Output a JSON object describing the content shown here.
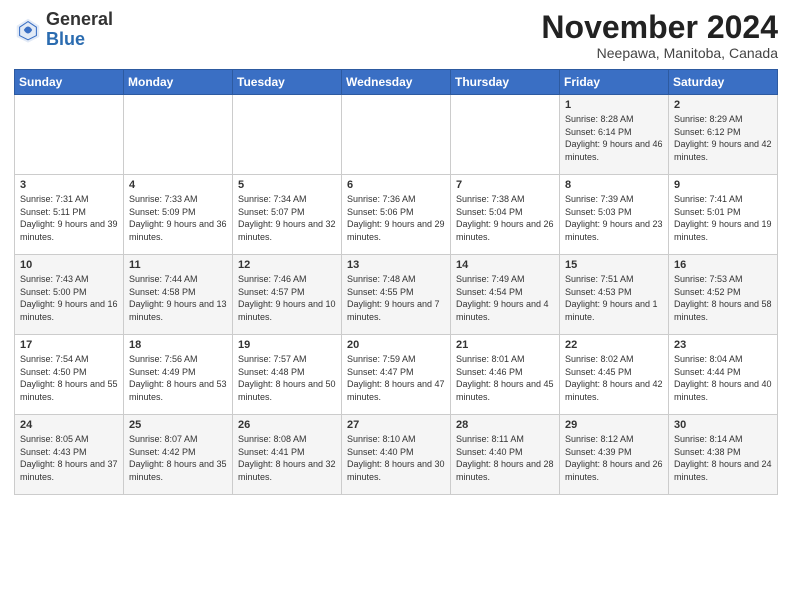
{
  "logo": {
    "general": "General",
    "blue": "Blue"
  },
  "title": "November 2024",
  "location": "Neepawa, Manitoba, Canada",
  "days_of_week": [
    "Sunday",
    "Monday",
    "Tuesday",
    "Wednesday",
    "Thursday",
    "Friday",
    "Saturday"
  ],
  "weeks": [
    [
      {
        "day": "",
        "info": ""
      },
      {
        "day": "",
        "info": ""
      },
      {
        "day": "",
        "info": ""
      },
      {
        "day": "",
        "info": ""
      },
      {
        "day": "",
        "info": ""
      },
      {
        "day": "1",
        "info": "Sunrise: 8:28 AM\nSunset: 6:14 PM\nDaylight: 9 hours and 46 minutes."
      },
      {
        "day": "2",
        "info": "Sunrise: 8:29 AM\nSunset: 6:12 PM\nDaylight: 9 hours and 42 minutes."
      }
    ],
    [
      {
        "day": "3",
        "info": "Sunrise: 7:31 AM\nSunset: 5:11 PM\nDaylight: 9 hours and 39 minutes."
      },
      {
        "day": "4",
        "info": "Sunrise: 7:33 AM\nSunset: 5:09 PM\nDaylight: 9 hours and 36 minutes."
      },
      {
        "day": "5",
        "info": "Sunrise: 7:34 AM\nSunset: 5:07 PM\nDaylight: 9 hours and 32 minutes."
      },
      {
        "day": "6",
        "info": "Sunrise: 7:36 AM\nSunset: 5:06 PM\nDaylight: 9 hours and 29 minutes."
      },
      {
        "day": "7",
        "info": "Sunrise: 7:38 AM\nSunset: 5:04 PM\nDaylight: 9 hours and 26 minutes."
      },
      {
        "day": "8",
        "info": "Sunrise: 7:39 AM\nSunset: 5:03 PM\nDaylight: 9 hours and 23 minutes."
      },
      {
        "day": "9",
        "info": "Sunrise: 7:41 AM\nSunset: 5:01 PM\nDaylight: 9 hours and 19 minutes."
      }
    ],
    [
      {
        "day": "10",
        "info": "Sunrise: 7:43 AM\nSunset: 5:00 PM\nDaylight: 9 hours and 16 minutes."
      },
      {
        "day": "11",
        "info": "Sunrise: 7:44 AM\nSunset: 4:58 PM\nDaylight: 9 hours and 13 minutes."
      },
      {
        "day": "12",
        "info": "Sunrise: 7:46 AM\nSunset: 4:57 PM\nDaylight: 9 hours and 10 minutes."
      },
      {
        "day": "13",
        "info": "Sunrise: 7:48 AM\nSunset: 4:55 PM\nDaylight: 9 hours and 7 minutes."
      },
      {
        "day": "14",
        "info": "Sunrise: 7:49 AM\nSunset: 4:54 PM\nDaylight: 9 hours and 4 minutes."
      },
      {
        "day": "15",
        "info": "Sunrise: 7:51 AM\nSunset: 4:53 PM\nDaylight: 9 hours and 1 minute."
      },
      {
        "day": "16",
        "info": "Sunrise: 7:53 AM\nSunset: 4:52 PM\nDaylight: 8 hours and 58 minutes."
      }
    ],
    [
      {
        "day": "17",
        "info": "Sunrise: 7:54 AM\nSunset: 4:50 PM\nDaylight: 8 hours and 55 minutes."
      },
      {
        "day": "18",
        "info": "Sunrise: 7:56 AM\nSunset: 4:49 PM\nDaylight: 8 hours and 53 minutes."
      },
      {
        "day": "19",
        "info": "Sunrise: 7:57 AM\nSunset: 4:48 PM\nDaylight: 8 hours and 50 minutes."
      },
      {
        "day": "20",
        "info": "Sunrise: 7:59 AM\nSunset: 4:47 PM\nDaylight: 8 hours and 47 minutes."
      },
      {
        "day": "21",
        "info": "Sunrise: 8:01 AM\nSunset: 4:46 PM\nDaylight: 8 hours and 45 minutes."
      },
      {
        "day": "22",
        "info": "Sunrise: 8:02 AM\nSunset: 4:45 PM\nDaylight: 8 hours and 42 minutes."
      },
      {
        "day": "23",
        "info": "Sunrise: 8:04 AM\nSunset: 4:44 PM\nDaylight: 8 hours and 40 minutes."
      }
    ],
    [
      {
        "day": "24",
        "info": "Sunrise: 8:05 AM\nSunset: 4:43 PM\nDaylight: 8 hours and 37 minutes."
      },
      {
        "day": "25",
        "info": "Sunrise: 8:07 AM\nSunset: 4:42 PM\nDaylight: 8 hours and 35 minutes."
      },
      {
        "day": "26",
        "info": "Sunrise: 8:08 AM\nSunset: 4:41 PM\nDaylight: 8 hours and 32 minutes."
      },
      {
        "day": "27",
        "info": "Sunrise: 8:10 AM\nSunset: 4:40 PM\nDaylight: 8 hours and 30 minutes."
      },
      {
        "day": "28",
        "info": "Sunrise: 8:11 AM\nSunset: 4:40 PM\nDaylight: 8 hours and 28 minutes."
      },
      {
        "day": "29",
        "info": "Sunrise: 8:12 AM\nSunset: 4:39 PM\nDaylight: 8 hours and 26 minutes."
      },
      {
        "day": "30",
        "info": "Sunrise: 8:14 AM\nSunset: 4:38 PM\nDaylight: 8 hours and 24 minutes."
      }
    ]
  ]
}
